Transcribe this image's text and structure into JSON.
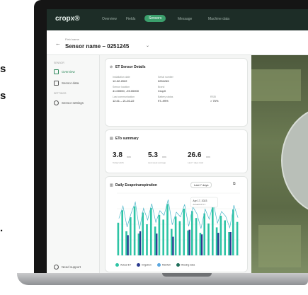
{
  "left_text": [
    "s",
    "s",
    "."
  ],
  "app": {
    "logo": "cropx®"
  },
  "topbar": {
    "nav": [
      "Overview",
      "Fields",
      "Sensors",
      "Message",
      "Machine data"
    ]
  },
  "header": {
    "parent": "Field name",
    "title": "Sensor name – 0251245"
  },
  "sidebar": {
    "sections": [
      {
        "heading": "SENSOR",
        "items": [
          {
            "label": "Overview",
            "icon": "overview-icon",
            "active": true
          },
          {
            "label": "Sensor data",
            "icon": "chart-icon",
            "active": false
          }
        ]
      },
      {
        "heading": "SETTINGS",
        "items": [
          {
            "label": "Sensor settings",
            "icon": "gear-icon",
            "active": false
          }
        ]
      }
    ],
    "footer": "Need support"
  },
  "details": {
    "title": "ET Sensor Details",
    "fields": [
      {
        "label": "Installation date",
        "value": "12-02-2022"
      },
      {
        "label": "Serial number",
        "value": "0251245"
      },
      {
        "label": "Sensor location",
        "value": "41.00000, -93.00000"
      },
      {
        "label": "Brand",
        "value": "CropX"
      },
      {
        "label": "Last communication",
        "value": "12:41 – 21-02-22"
      },
      {
        "label": "Battery status",
        "value": "97–99%"
      },
      {
        "label": "RSSI",
        "value": "> 75%"
      }
    ]
  },
  "summary": {
    "title": "ETo summary",
    "items": [
      {
        "value": "3.8",
        "unit": "mm",
        "caption": "Today's ETo"
      },
      {
        "value": "5.3",
        "unit": "mm",
        "caption": "Last week average"
      },
      {
        "value": "26.6",
        "unit": "mm",
        "caption": "Last 7 days total"
      }
    ]
  },
  "chart_card": {
    "title": "Daily Evapotranspiration",
    "range": "Last 7 days",
    "tooltip": {
      "date": "Apr 17, 2023",
      "line": "Actual ET 5.7"
    }
  },
  "chart_data": {
    "type": "bar",
    "title": "Daily Evapotranspiration",
    "ylabel": "mm",
    "ylim": [
      0,
      8
    ],
    "series": [
      {
        "name": "Actual ET",
        "values": [
          4.2,
          5.8,
          3.1,
          4.9,
          6.3,
          2.8,
          5.5,
          4.0,
          6.1,
          3.7,
          5.2,
          4.6,
          6.6,
          3.4,
          5.0,
          4.4,
          6.0,
          3.2,
          5.7,
          4.8,
          2.9,
          5.4,
          4.1,
          6.2,
          3.6,
          5.1,
          4.5,
          3.0,
          5.9,
          4.3
        ]
      },
      {
        "name": "Irrigation",
        "values": [
          0,
          0,
          2.6,
          0,
          0,
          3.1,
          0,
          0,
          0,
          2.8,
          0,
          0,
          0,
          2.4,
          0,
          0,
          0,
          3.3,
          0,
          0,
          2.7,
          0,
          0,
          0,
          2.9,
          0,
          0,
          3.0,
          0,
          0
        ]
      }
    ],
    "legend": [
      "Actual ET",
      "Irrigation",
      "Rainfall",
      "Missing data"
    ]
  },
  "colors": {
    "actual": "#2ec4a5",
    "irrigation": "#2a3a8f",
    "rainfall": "#5aa7e0",
    "missing": "#1f6e5a",
    "accent": "#3b9f6c"
  }
}
